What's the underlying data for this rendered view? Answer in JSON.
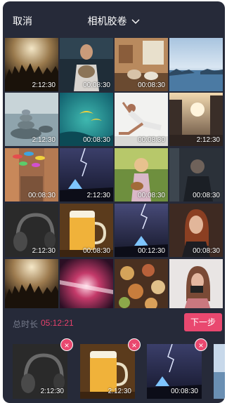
{
  "header": {
    "cancel_label": "取消",
    "album_title": "相机胶卷"
  },
  "grid": {
    "items": [
      {
        "id": "concert-crowd",
        "duration": "2:12:30"
      },
      {
        "id": "man-with-animal",
        "duration": "00:08:30"
      },
      {
        "id": "room-interior",
        "duration": "00:08:30"
      },
      {
        "id": "sea-sunset",
        "duration": ""
      },
      {
        "id": "stone-stack-river",
        "duration": "2:12:30"
      },
      {
        "id": "paragliders-ocean",
        "duration": "00:08:30"
      },
      {
        "id": "yoga-woman",
        "duration": "00:08:30"
      },
      {
        "id": "city-street-sunset",
        "duration": "2:12:30"
      },
      {
        "id": "umbrellas-street",
        "duration": "00:08:30"
      },
      {
        "id": "lightning-tent",
        "duration": "2:12:30"
      },
      {
        "id": "girl-ukulele",
        "duration": "00:08:30"
      },
      {
        "id": "man-dark",
        "duration": "00:08:30"
      },
      {
        "id": "headphones-bw",
        "duration": "2:12:30"
      },
      {
        "id": "beer-mug",
        "duration": "00:08:30"
      },
      {
        "id": "lightning-tent-2",
        "duration": "00:12:30"
      },
      {
        "id": "woman-portrait",
        "duration": "00:08:30"
      },
      {
        "id": "concert-crowd-2",
        "duration": ""
      },
      {
        "id": "fire-lights",
        "duration": ""
      },
      {
        "id": "food-table",
        "duration": ""
      },
      {
        "id": "girl-camera",
        "duration": ""
      }
    ]
  },
  "footer": {
    "total_label": "总时长",
    "total_value": "05:12:21",
    "next_label": "下一步"
  },
  "selected": {
    "items": [
      {
        "id": "headphones-bw",
        "duration": "2:12:30",
        "remove_label": "×"
      },
      {
        "id": "beer-mug",
        "duration": "2:12:30",
        "remove_label": "×"
      },
      {
        "id": "lightning-tent",
        "duration": "00:08:30",
        "remove_label": "×"
      }
    ]
  },
  "colors": {
    "background": "#262a39",
    "accent": "#e9486f",
    "total_value": "#e4416b",
    "muted_text": "#767b8c"
  }
}
